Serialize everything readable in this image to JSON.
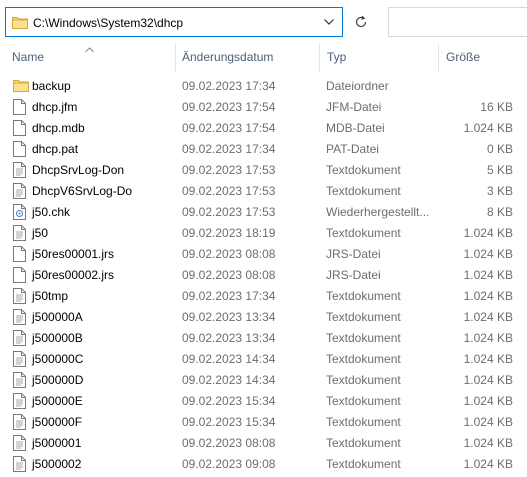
{
  "address": {
    "path": "C:\\Windows\\System32\\dhcp",
    "icon": "folder-icon"
  },
  "columns": {
    "name": "Name",
    "date": "Änderungsdatum",
    "type": "Typ",
    "size": "Größe"
  },
  "colors": {
    "accent": "#0078d7",
    "header_text": "#4c607a",
    "meta_text": "#6d6d6d",
    "folder": "#f8d775"
  },
  "files": [
    {
      "name": "backup",
      "date": "09.02.2023 17:34",
      "type": "Dateiordner",
      "size": "",
      "icon": "folder-icon"
    },
    {
      "name": "dhcp.jfm",
      "date": "09.02.2023 17:54",
      "type": "JFM-Datei",
      "size": "16 KB",
      "icon": "file-icon"
    },
    {
      "name": "dhcp.mdb",
      "date": "09.02.2023 17:54",
      "type": "MDB-Datei",
      "size": "1.024 KB",
      "icon": "file-icon"
    },
    {
      "name": "dhcp.pat",
      "date": "09.02.2023 17:34",
      "type": "PAT-Datei",
      "size": "0 KB",
      "icon": "file-icon"
    },
    {
      "name": "DhcpSrvLog-Don",
      "date": "09.02.2023 17:53",
      "type": "Textdokument",
      "size": "5 KB",
      "icon": "text-file-icon"
    },
    {
      "name": "DhcpV6SrvLog-Do",
      "date": "09.02.2023 17:53",
      "type": "Textdokument",
      "size": "3 KB",
      "icon": "text-file-icon"
    },
    {
      "name": "j50.chk",
      "date": "09.02.2023 17:53",
      "type": "Wiederhergestellt...",
      "size": "8 KB",
      "icon": "recovered-file-icon"
    },
    {
      "name": "j50",
      "date": "09.02.2023 18:19",
      "type": "Textdokument",
      "size": "1.024 KB",
      "icon": "text-file-icon"
    },
    {
      "name": "j50res00001.jrs",
      "date": "09.02.2023 08:08",
      "type": "JRS-Datei",
      "size": "1.024 KB",
      "icon": "file-icon"
    },
    {
      "name": "j50res00002.jrs",
      "date": "09.02.2023 08:08",
      "type": "JRS-Datei",
      "size": "1.024 KB",
      "icon": "file-icon"
    },
    {
      "name": "j50tmp",
      "date": "09.02.2023 17:34",
      "type": "Textdokument",
      "size": "1.024 KB",
      "icon": "text-file-icon"
    },
    {
      "name": "j500000A",
      "date": "09.02.2023 13:34",
      "type": "Textdokument",
      "size": "1.024 KB",
      "icon": "text-file-icon"
    },
    {
      "name": "j500000B",
      "date": "09.02.2023 13:34",
      "type": "Textdokument",
      "size": "1.024 KB",
      "icon": "text-file-icon"
    },
    {
      "name": "j500000C",
      "date": "09.02.2023 14:34",
      "type": "Textdokument",
      "size": "1.024 KB",
      "icon": "text-file-icon"
    },
    {
      "name": "j500000D",
      "date": "09.02.2023 14:34",
      "type": "Textdokument",
      "size": "1.024 KB",
      "icon": "text-file-icon"
    },
    {
      "name": "j500000E",
      "date": "09.02.2023 15:34",
      "type": "Textdokument",
      "size": "1.024 KB",
      "icon": "text-file-icon"
    },
    {
      "name": "j500000F",
      "date": "09.02.2023 15:34",
      "type": "Textdokument",
      "size": "1.024 KB",
      "icon": "text-file-icon"
    },
    {
      "name": "j5000001",
      "date": "09.02.2023 08:08",
      "type": "Textdokument",
      "size": "1.024 KB",
      "icon": "text-file-icon"
    },
    {
      "name": "j5000002",
      "date": "09.02.2023 09:08",
      "type": "Textdokument",
      "size": "1.024 KB",
      "icon": "text-file-icon"
    }
  ]
}
